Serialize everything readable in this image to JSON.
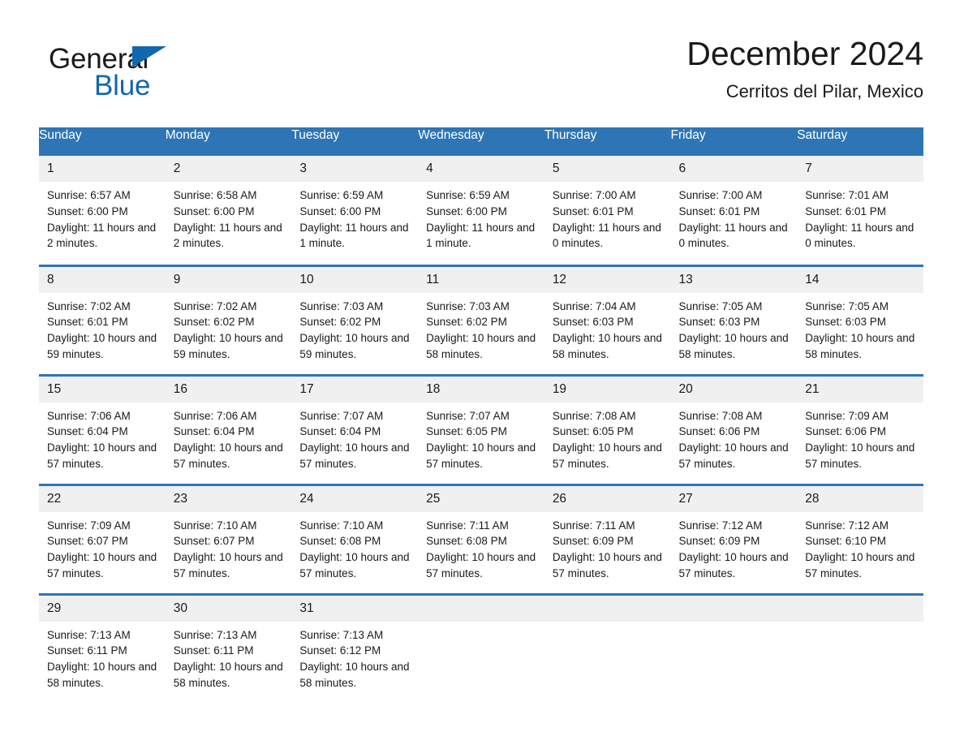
{
  "brand": {
    "name_part1": "General",
    "name_part2": "Blue",
    "triangle_icon": "brand-triangle-icon",
    "accent_color": "#1167b1"
  },
  "header": {
    "month_title": "December 2024",
    "location": "Cerritos del Pilar, Mexico"
  },
  "theme": {
    "header_blue": "#2e75b6",
    "daynum_band": "#f0f0f0",
    "divider_blue": "#2e75b6",
    "text": "#1a1a1a"
  },
  "calendar": {
    "weekday_headers": [
      "Sunday",
      "Monday",
      "Tuesday",
      "Wednesday",
      "Thursday",
      "Friday",
      "Saturday"
    ],
    "labels": {
      "sunrise_prefix": "Sunrise:",
      "sunset_prefix": "Sunset:",
      "daylight_prefix": "Daylight:"
    },
    "weeks": [
      [
        {
          "day": "1",
          "sunrise": "Sunrise: 6:57 AM",
          "sunset": "Sunset: 6:00 PM",
          "daylight": "Daylight: 11 hours and 2 minutes."
        },
        {
          "day": "2",
          "sunrise": "Sunrise: 6:58 AM",
          "sunset": "Sunset: 6:00 PM",
          "daylight": "Daylight: 11 hours and 2 minutes."
        },
        {
          "day": "3",
          "sunrise": "Sunrise: 6:59 AM",
          "sunset": "Sunset: 6:00 PM",
          "daylight": "Daylight: 11 hours and 1 minute."
        },
        {
          "day": "4",
          "sunrise": "Sunrise: 6:59 AM",
          "sunset": "Sunset: 6:00 PM",
          "daylight": "Daylight: 11 hours and 1 minute."
        },
        {
          "day": "5",
          "sunrise": "Sunrise: 7:00 AM",
          "sunset": "Sunset: 6:01 PM",
          "daylight": "Daylight: 11 hours and 0 minutes."
        },
        {
          "day": "6",
          "sunrise": "Sunrise: 7:00 AM",
          "sunset": "Sunset: 6:01 PM",
          "daylight": "Daylight: 11 hours and 0 minutes."
        },
        {
          "day": "7",
          "sunrise": "Sunrise: 7:01 AM",
          "sunset": "Sunset: 6:01 PM",
          "daylight": "Daylight: 11 hours and 0 minutes."
        }
      ],
      [
        {
          "day": "8",
          "sunrise": "Sunrise: 7:02 AM",
          "sunset": "Sunset: 6:01 PM",
          "daylight": "Daylight: 10 hours and 59 minutes."
        },
        {
          "day": "9",
          "sunrise": "Sunrise: 7:02 AM",
          "sunset": "Sunset: 6:02 PM",
          "daylight": "Daylight: 10 hours and 59 minutes."
        },
        {
          "day": "10",
          "sunrise": "Sunrise: 7:03 AM",
          "sunset": "Sunset: 6:02 PM",
          "daylight": "Daylight: 10 hours and 59 minutes."
        },
        {
          "day": "11",
          "sunrise": "Sunrise: 7:03 AM",
          "sunset": "Sunset: 6:02 PM",
          "daylight": "Daylight: 10 hours and 58 minutes."
        },
        {
          "day": "12",
          "sunrise": "Sunrise: 7:04 AM",
          "sunset": "Sunset: 6:03 PM",
          "daylight": "Daylight: 10 hours and 58 minutes."
        },
        {
          "day": "13",
          "sunrise": "Sunrise: 7:05 AM",
          "sunset": "Sunset: 6:03 PM",
          "daylight": "Daylight: 10 hours and 58 minutes."
        },
        {
          "day": "14",
          "sunrise": "Sunrise: 7:05 AM",
          "sunset": "Sunset: 6:03 PM",
          "daylight": "Daylight: 10 hours and 58 minutes."
        }
      ],
      [
        {
          "day": "15",
          "sunrise": "Sunrise: 7:06 AM",
          "sunset": "Sunset: 6:04 PM",
          "daylight": "Daylight: 10 hours and 57 minutes."
        },
        {
          "day": "16",
          "sunrise": "Sunrise: 7:06 AM",
          "sunset": "Sunset: 6:04 PM",
          "daylight": "Daylight: 10 hours and 57 minutes."
        },
        {
          "day": "17",
          "sunrise": "Sunrise: 7:07 AM",
          "sunset": "Sunset: 6:04 PM",
          "daylight": "Daylight: 10 hours and 57 minutes."
        },
        {
          "day": "18",
          "sunrise": "Sunrise: 7:07 AM",
          "sunset": "Sunset: 6:05 PM",
          "daylight": "Daylight: 10 hours and 57 minutes."
        },
        {
          "day": "19",
          "sunrise": "Sunrise: 7:08 AM",
          "sunset": "Sunset: 6:05 PM",
          "daylight": "Daylight: 10 hours and 57 minutes."
        },
        {
          "day": "20",
          "sunrise": "Sunrise: 7:08 AM",
          "sunset": "Sunset: 6:06 PM",
          "daylight": "Daylight: 10 hours and 57 minutes."
        },
        {
          "day": "21",
          "sunrise": "Sunrise: 7:09 AM",
          "sunset": "Sunset: 6:06 PM",
          "daylight": "Daylight: 10 hours and 57 minutes."
        }
      ],
      [
        {
          "day": "22",
          "sunrise": "Sunrise: 7:09 AM",
          "sunset": "Sunset: 6:07 PM",
          "daylight": "Daylight: 10 hours and 57 minutes."
        },
        {
          "day": "23",
          "sunrise": "Sunrise: 7:10 AM",
          "sunset": "Sunset: 6:07 PM",
          "daylight": "Daylight: 10 hours and 57 minutes."
        },
        {
          "day": "24",
          "sunrise": "Sunrise: 7:10 AM",
          "sunset": "Sunset: 6:08 PM",
          "daylight": "Daylight: 10 hours and 57 minutes."
        },
        {
          "day": "25",
          "sunrise": "Sunrise: 7:11 AM",
          "sunset": "Sunset: 6:08 PM",
          "daylight": "Daylight: 10 hours and 57 minutes."
        },
        {
          "day": "26",
          "sunrise": "Sunrise: 7:11 AM",
          "sunset": "Sunset: 6:09 PM",
          "daylight": "Daylight: 10 hours and 57 minutes."
        },
        {
          "day": "27",
          "sunrise": "Sunrise: 7:12 AM",
          "sunset": "Sunset: 6:09 PM",
          "daylight": "Daylight: 10 hours and 57 minutes."
        },
        {
          "day": "28",
          "sunrise": "Sunrise: 7:12 AM",
          "sunset": "Sunset: 6:10 PM",
          "daylight": "Daylight: 10 hours and 57 minutes."
        }
      ],
      [
        {
          "day": "29",
          "sunrise": "Sunrise: 7:13 AM",
          "sunset": "Sunset: 6:11 PM",
          "daylight": "Daylight: 10 hours and 58 minutes."
        },
        {
          "day": "30",
          "sunrise": "Sunrise: 7:13 AM",
          "sunset": "Sunset: 6:11 PM",
          "daylight": "Daylight: 10 hours and 58 minutes."
        },
        {
          "day": "31",
          "sunrise": "Sunrise: 7:13 AM",
          "sunset": "Sunset: 6:12 PM",
          "daylight": "Daylight: 10 hours and 58 minutes."
        },
        {
          "day": "",
          "sunrise": "",
          "sunset": "",
          "daylight": ""
        },
        {
          "day": "",
          "sunrise": "",
          "sunset": "",
          "daylight": ""
        },
        {
          "day": "",
          "sunrise": "",
          "sunset": "",
          "daylight": ""
        },
        {
          "day": "",
          "sunrise": "",
          "sunset": "",
          "daylight": ""
        }
      ]
    ]
  }
}
